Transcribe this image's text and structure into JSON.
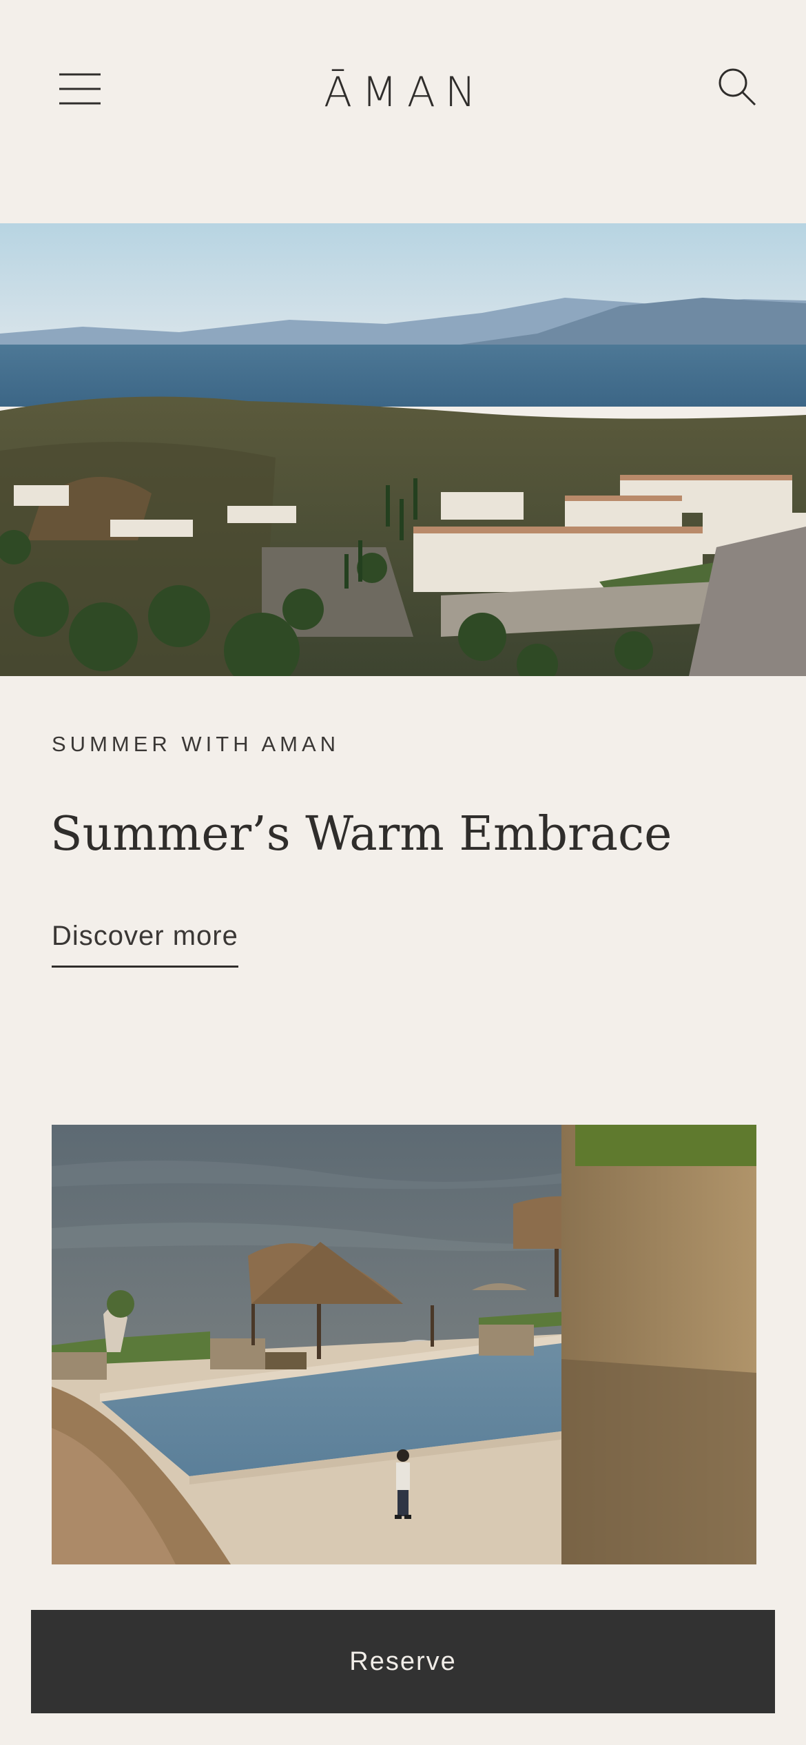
{
  "header": {
    "brand": "ĀMAN",
    "menu_icon": "hamburger-menu-icon",
    "search_icon": "search-icon"
  },
  "hero": {
    "image": "aerial-resort-coastline-photo"
  },
  "promo": {
    "eyebrow": "SUMMER WITH AMAN",
    "title": "Summer’s Warm Embrace",
    "cta_label": "Discover more"
  },
  "feature": {
    "image": "poolside-thatched-cabanas-photo"
  },
  "footer": {
    "reserve_label": "Reserve"
  },
  "colors": {
    "background": "#f3efea",
    "text": "#2f2d2b",
    "button_bg": "#323232",
    "button_text": "#f1ede8"
  }
}
